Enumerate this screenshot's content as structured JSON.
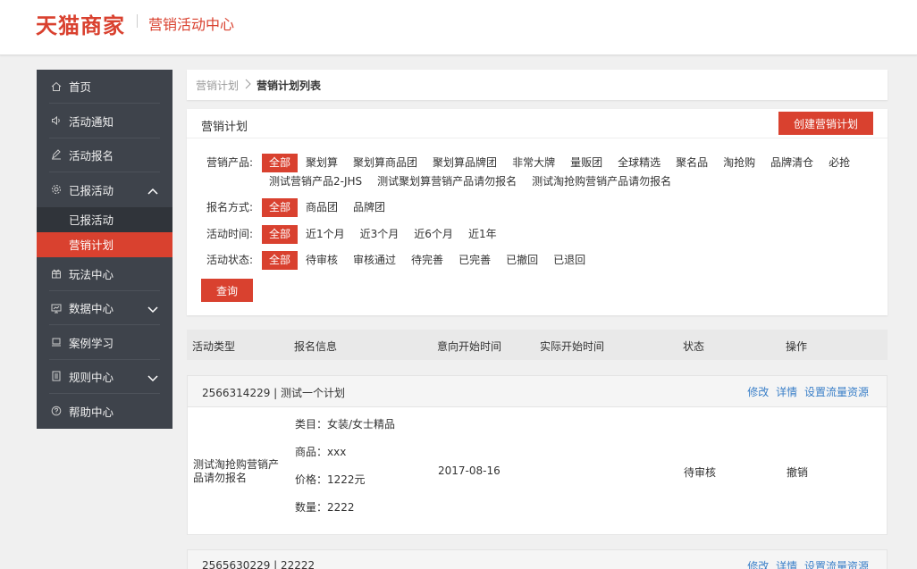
{
  "header": {
    "logo": "天猫商家",
    "title": "营销活动中心"
  },
  "sidebar": {
    "items": [
      {
        "label": "首页",
        "icon": "home-icon"
      },
      {
        "label": "活动通知",
        "icon": "speaker-icon"
      },
      {
        "label": "活动报名",
        "icon": "pen-icon"
      },
      {
        "label": "已报活动",
        "icon": "gear-icon",
        "expanded": true
      },
      {
        "label": "玩法中心",
        "icon": "gift-icon"
      },
      {
        "label": "数据中心",
        "icon": "monitor-icon"
      },
      {
        "label": "案例学习",
        "icon": "screen-icon"
      },
      {
        "label": "规则中心",
        "icon": "document-icon"
      },
      {
        "label": "帮助中心",
        "icon": "help-icon"
      }
    ],
    "subitems": [
      "已报活动",
      "营销计划"
    ]
  },
  "breadcrumb": {
    "parent": "营销计划",
    "current": "营销计划列表"
  },
  "filter": {
    "title": "营销计划",
    "create_label": "创建营销计划",
    "query_label": "查询",
    "product": {
      "label": "营销产品:",
      "options": [
        "全部",
        "聚划算",
        "聚划算商品团",
        "聚划算品牌团",
        "非常大牌",
        "量贩团",
        "全球精选",
        "聚名品",
        "淘抢购",
        "品牌清仓",
        "必抢",
        "测试营销产品2-JHS",
        "测试聚划算营销产品请勿报名",
        "测试淘抢购营销产品请勿报名"
      ]
    },
    "method": {
      "label": "报名方式:",
      "options": [
        "全部",
        "商品团",
        "品牌团"
      ]
    },
    "time": {
      "label": "活动时间:",
      "options": [
        "全部",
        "近1个月",
        "近3个月",
        "近6个月",
        "近1年"
      ]
    },
    "status": {
      "label": "活动状态:",
      "options": [
        "全部",
        "待审核",
        "审核通过",
        "待完善",
        "已完善",
        "已撤回",
        "已退回"
      ]
    }
  },
  "table": {
    "columns": [
      "活动类型",
      "报名信息",
      "意向开始时间",
      "实际开始时间",
      "状态",
      "操作"
    ],
    "groups": [
      {
        "title": "2566314229 | 测试一个计划",
        "actions": [
          "修改",
          "详情",
          "设置流量资源"
        ],
        "row": {
          "type": "测试淘抢购营销产品请勿报名",
          "info": [
            "类目：女装/女士精品",
            "商品：xxx",
            "价格：1222元",
            "数量：2222"
          ],
          "intended_start": "2017-08-16",
          "actual_start": "",
          "status": "待审核",
          "op": "撤销"
        }
      },
      {
        "title": "2565630229 | 22222",
        "actions": [
          "修改",
          "详情",
          "设置流量资源"
        ]
      }
    ]
  },
  "colors": {
    "accent": "#d9412f",
    "sidebar_bg": "#3e434b",
    "link": "#3a7fc8"
  }
}
